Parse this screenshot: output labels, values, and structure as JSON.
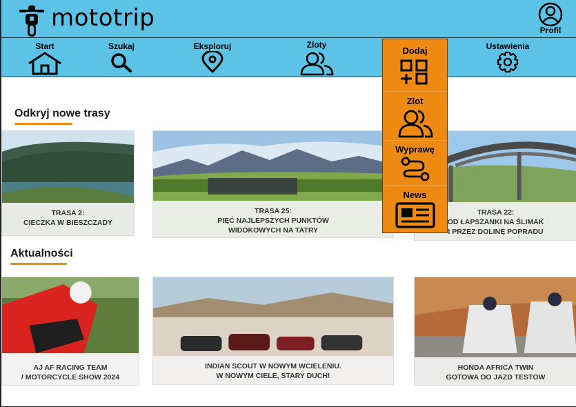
{
  "app": {
    "title": "mototrip"
  },
  "profile": {
    "label": "Profil"
  },
  "nav": {
    "start": "Start",
    "search": "Szukaj",
    "explore": "Eksploruj",
    "rallies": "Zloty",
    "add": "Dodaj",
    "settings": "Ustawienia"
  },
  "add_menu": {
    "rally": "Zlot",
    "trip": "Wyprawę",
    "news": "News"
  },
  "routes": {
    "heading": "Odkryj nowe trasy",
    "cards": [
      {
        "line1": "TRASA 2:",
        "line2": "CIECZKA W BIESZCZADY"
      },
      {
        "line1": "TRASA 25:",
        "line2": "PIĘĆ NAJLEPSZYCH PUNKTÓW",
        "line3": "WIDOKOWYCH NA TATRY"
      },
      {
        "line1": "TRASA 22:",
        "line2": "OD ŁAPSZANKI NA ŚLIMAK",
        "line3": "I PRZEZ DOLINĘ POPRADU"
      }
    ]
  },
  "news": {
    "heading": "Aktualności",
    "cards": [
      {
        "line1": "AJ AF RACING TEAM",
        "line2": "/ MOTORCYCLE SHOW 2024"
      },
      {
        "line1": "INDIAN SCOUT W NOWYM WCIELENIU.",
        "line2": "W NOWYM CIELE, STARY DUCH!"
      },
      {
        "line1": "HONDA AFRICA TWIN",
        "line2": "GOTOWA DO JAZD TESTOW"
      }
    ]
  },
  "colors": {
    "header": "#5cc3e6",
    "accent": "#ee8a12"
  }
}
